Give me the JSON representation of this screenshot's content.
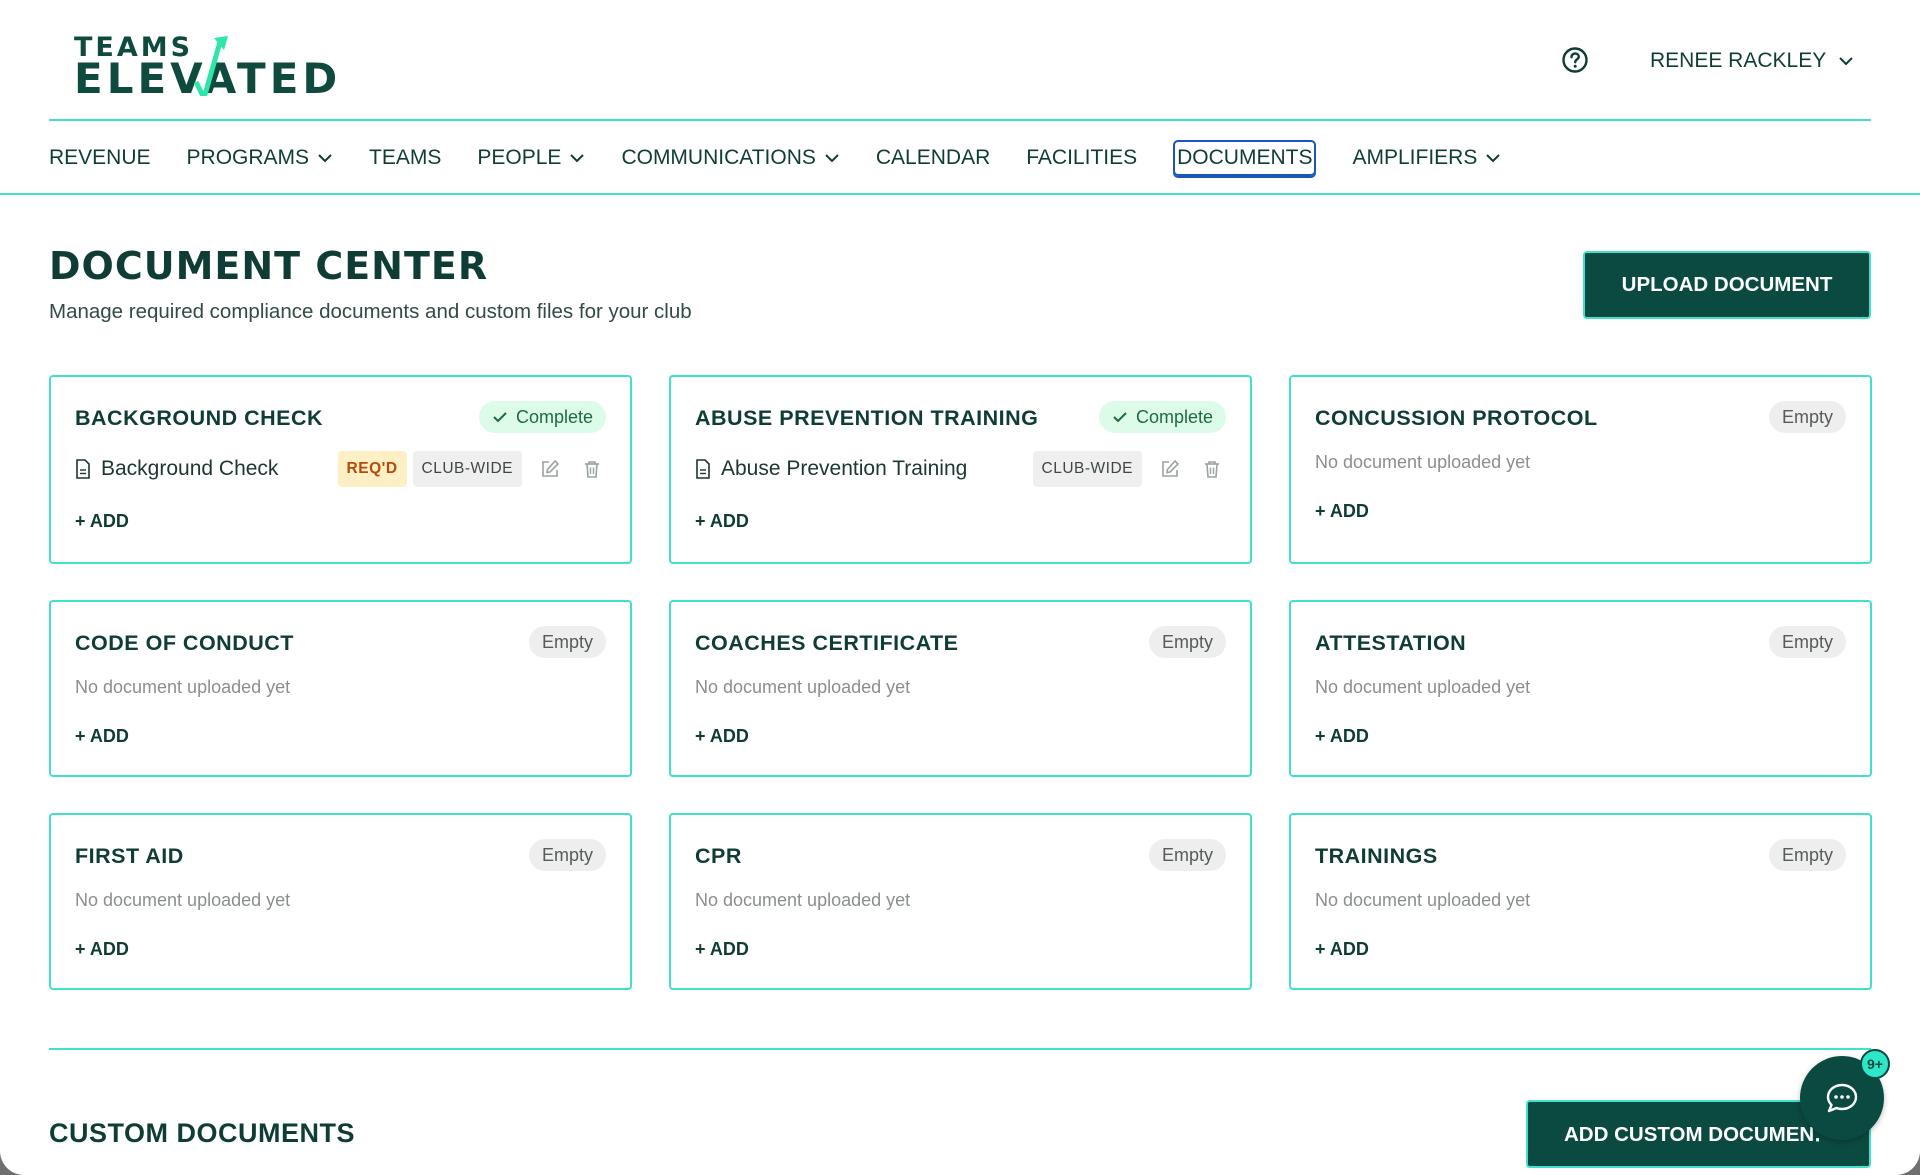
{
  "header": {
    "logo_top": "TEAMS",
    "logo_bottom": "ELEVATED",
    "user_name": "RENEE RACKLEY"
  },
  "nav": {
    "items": [
      {
        "label": "REVENUE",
        "dropdown": false
      },
      {
        "label": "PROGRAMS",
        "dropdown": true
      },
      {
        "label": "TEAMS",
        "dropdown": false
      },
      {
        "label": "PEOPLE",
        "dropdown": true
      },
      {
        "label": "COMMUNICATIONS",
        "dropdown": true
      },
      {
        "label": "CALENDAR",
        "dropdown": false
      },
      {
        "label": "FACILITIES",
        "dropdown": false
      },
      {
        "label": "DOCUMENTS",
        "dropdown": false,
        "active": true
      },
      {
        "label": "AMPLIFIERS",
        "dropdown": true
      }
    ]
  },
  "page": {
    "title": "DOCUMENT CENTER",
    "subtitle": "Manage required compliance documents and custom files for your club",
    "upload_label": "UPLOAD DOCUMENT"
  },
  "cards": [
    {
      "title": "BACKGROUND CHECK",
      "status": "Complete",
      "doc_name": "Background Check",
      "req_tag": "REQ'D",
      "scope_tag": "CLUB-WIDE",
      "add_label": "+ ADD"
    },
    {
      "title": "ABUSE PREVENTION TRAINING",
      "status": "Complete",
      "doc_name": "Abuse Prevention Training",
      "scope_tag": "CLUB-WIDE",
      "add_label": "+ ADD"
    },
    {
      "title": "CONCUSSION PROTOCOL",
      "status": "Empty",
      "empty_note": "No document uploaded yet",
      "add_label": "+ ADD"
    },
    {
      "title": "CODE OF CONDUCT",
      "status": "Empty",
      "empty_note": "No document uploaded yet",
      "add_label": "+ ADD"
    },
    {
      "title": "COACHES CERTIFICATE",
      "status": "Empty",
      "empty_note": "No document uploaded yet",
      "add_label": "+ ADD"
    },
    {
      "title": "ATTESTATION",
      "status": "Empty",
      "empty_note": "No document uploaded yet",
      "add_label": "+ ADD"
    },
    {
      "title": "FIRST AID",
      "status": "Empty",
      "empty_note": "No document uploaded yet",
      "add_label": "+ ADD"
    },
    {
      "title": "CPR",
      "status": "Empty",
      "empty_note": "No document uploaded yet",
      "add_label": "+ ADD"
    },
    {
      "title": "TRAININGS",
      "status": "Empty",
      "empty_note": "No document uploaded yet",
      "add_label": "+ ADD"
    }
  ],
  "custom": {
    "title": "CUSTOM DOCUMENTS",
    "add_label": "ADD CUSTOM DOCUMEN․"
  },
  "chat": {
    "badge": "9+"
  },
  "colors": {
    "brand_dark": "#0b4a40",
    "accent_teal": "#3fe0cc",
    "complete_bg": "#dcfbe9",
    "req_bg": "#fdf0c4",
    "active_outline": "#1a56b8"
  }
}
